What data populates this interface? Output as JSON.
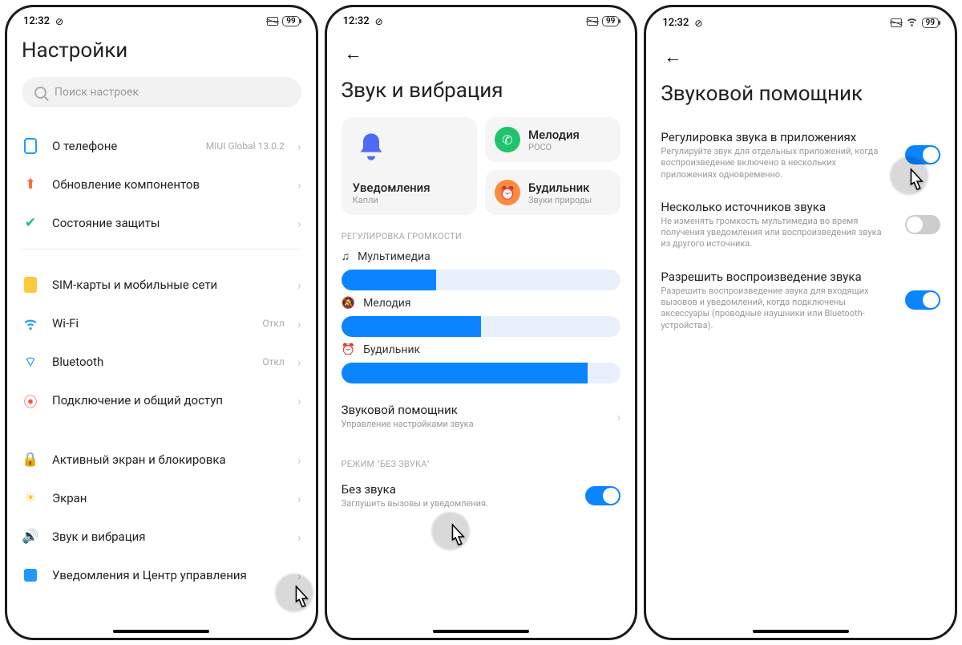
{
  "status": {
    "time": "12:32",
    "battery": "99"
  },
  "phone1": {
    "title": "Настройки",
    "search_placeholder": "Поиск настроек",
    "items": [
      {
        "label": "О телефоне",
        "side": "MIUI Global 13.0.2"
      },
      {
        "label": "Обновление компонентов",
        "side": ""
      },
      {
        "label": "Состояние защиты",
        "side": ""
      }
    ],
    "items2": [
      {
        "label": "SIM-карты и мобильные сети",
        "side": ""
      },
      {
        "label": "Wi-Fi",
        "side": "Откл"
      },
      {
        "label": "Bluetooth",
        "side": "Откл"
      },
      {
        "label": "Подключение и общий доступ",
        "side": ""
      }
    ],
    "items3": [
      {
        "label": "Активный экран и блокировка",
        "side": ""
      },
      {
        "label": "Экран",
        "side": ""
      },
      {
        "label": "Звук и вибрация",
        "side": ""
      },
      {
        "label": "Уведомления и Центр управления",
        "side": ""
      }
    ]
  },
  "phone2": {
    "title": "Звук и вибрация",
    "cards": {
      "notif": {
        "title": "Уведомления",
        "sub": "Капли"
      },
      "ring": {
        "title": "Мелодия",
        "sub": "POCO"
      },
      "alarm": {
        "title": "Будильник",
        "sub": "Звуки природы"
      }
    },
    "section1": "РЕГУЛИРОВКА ГРОМКОСТИ",
    "sliders": [
      {
        "label": "Мультимедиа",
        "value": 34
      },
      {
        "label": "Мелодия",
        "value": 50
      },
      {
        "label": "Будильник",
        "value": 88
      }
    ],
    "assistant": {
      "title": "Звуковой помощник",
      "desc": "Управление настройками звука"
    },
    "section2": "РЕЖИМ \"БЕЗ ЗВУКА\"",
    "silent": {
      "title": "Без звука",
      "desc": "Заглушить вызовы и уведомления.",
      "on": true
    }
  },
  "phone3": {
    "title": "Звуковой помощник",
    "items": [
      {
        "title": "Регулировка звука в приложениях",
        "desc": "Регулируйте звук для отдельных приложений, когда воспроизведение включено в нескольких приложениях одновременно.",
        "on": true
      },
      {
        "title": "Несколько источников звука",
        "desc": "Не изменять громкость мультимедиа во время получения уведомления или воспроизведения звука из другого источника.",
        "on": false
      },
      {
        "title": "Разрешить воспроизведение звука",
        "desc": "Разрешить воспроизведение звука для входящих вызовов и уведомлений, когда подключены аксессуары (проводные наушники или Bluetooth-устройства).",
        "on": true
      }
    ]
  }
}
